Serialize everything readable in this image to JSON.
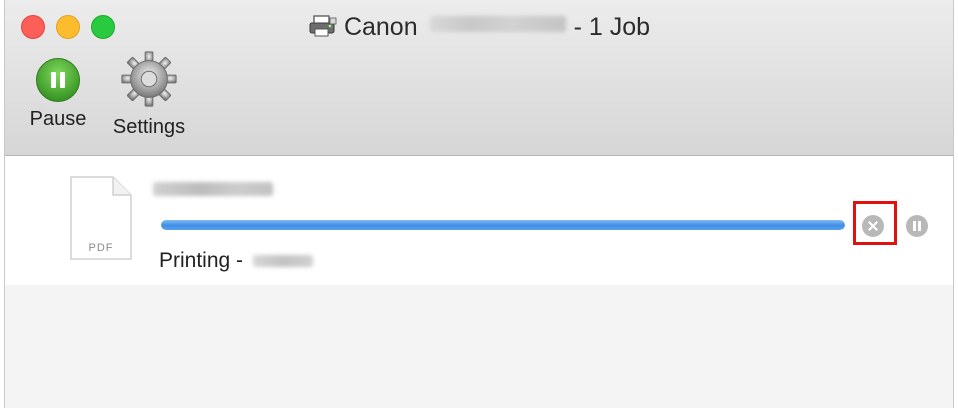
{
  "window": {
    "title_prefix": "Canon",
    "title_suffix": "- 1 Job"
  },
  "toolbar": {
    "pause_label": "Pause",
    "settings_label": "Settings"
  },
  "job": {
    "doc_type": "PDF",
    "status_label": "Printing -",
    "progress_percent": 100
  },
  "colors": {
    "progress": "#3f8ee6",
    "highlight": "#e0120f",
    "close": "#fc5f57",
    "minimize": "#fdbc2e",
    "maximize": "#29c940"
  }
}
